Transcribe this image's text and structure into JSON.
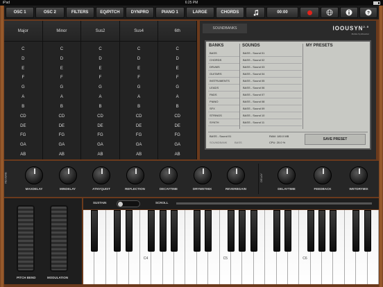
{
  "status": {
    "carrier": "iPad",
    "time": "6:25 PM"
  },
  "toolbar": {
    "items": [
      "OSC 1",
      "OSC 2",
      "FILTERS",
      "EQ/PITCH",
      "DYNPRO",
      "PIANO 1",
      "LARGE",
      "CHORDS"
    ],
    "note_icon": "music-note-icon",
    "time_display": "00:00",
    "record_icon": "record-icon",
    "globe_icon": "globe-icon",
    "info_icon": "info-icon",
    "help_icon": "help-icon",
    "record_color": "#e0231b"
  },
  "chords": {
    "headers": [
      "Major",
      "Minor",
      "Sus2",
      "Sus4",
      "6th"
    ],
    "rows": [
      "C",
      "D",
      "E",
      "F",
      "G",
      "A",
      "B",
      "CD",
      "DE",
      "FG",
      "GA",
      "AB"
    ]
  },
  "soundbank": {
    "tab": "SOUNDBANKS",
    "logo": "IOOUSYN",
    "logo_version": "2.0",
    "logo_sub": "Mobile Synthesizer",
    "banks_header": "BANKS",
    "sounds_header": "SOUNDS",
    "presets_header": "MY PRESETS",
    "banks": [
      "BASS",
      "CHORDS",
      "DRUMS",
      "GUITARS",
      "INSTRUMENTS",
      "LEADS",
      "PADS",
      "PIANO",
      "SFX",
      "STRINGS",
      "SYNTH"
    ],
    "sounds": [
      "BASS - Sound 01",
      "BASS - Sound 02",
      "BASS - Sound 03",
      "BASS - Sound 04",
      "BASS - Sound 05",
      "BASS - Sound 06",
      "BASS - Sound 07",
      "BASS - Sound 08",
      "BASS - Sound 09",
      "BASS - Sound 10",
      "BASS - Sound 11"
    ],
    "current": "BASS - Sound 01",
    "soundbank_label": "SOUNDBANK",
    "soundbank_value": "BASS",
    "ram_label": "RAM:",
    "ram_value": "180.0 MB",
    "cpu_label": "CPU:",
    "cpu_value": "20.0",
    "cpu_unit": "%",
    "save_label": "SAVE PRESET"
  },
  "effects": {
    "reverb_label": "REVERB",
    "delay_label": "DELAY",
    "reverb_knobs": [
      "MAXDELAY",
      "MINDELAY",
      "ATNYQUIST",
      "REFLECTION",
      "DECAYTIME",
      "DRYWETMIX",
      "REVERBGAIN"
    ],
    "delay_knobs": [
      "DELAYTIME",
      "FEEDBACK",
      "WETDRYMIX"
    ]
  },
  "controls": {
    "sustain_label": "SUSTAIN",
    "scroll_label": "SCROLL",
    "pitch_bend_label": "PITCH BEND",
    "modulation_label": "MODULATION"
  },
  "keyboard": {
    "labels": [
      "C4",
      "C5",
      "C6"
    ]
  }
}
